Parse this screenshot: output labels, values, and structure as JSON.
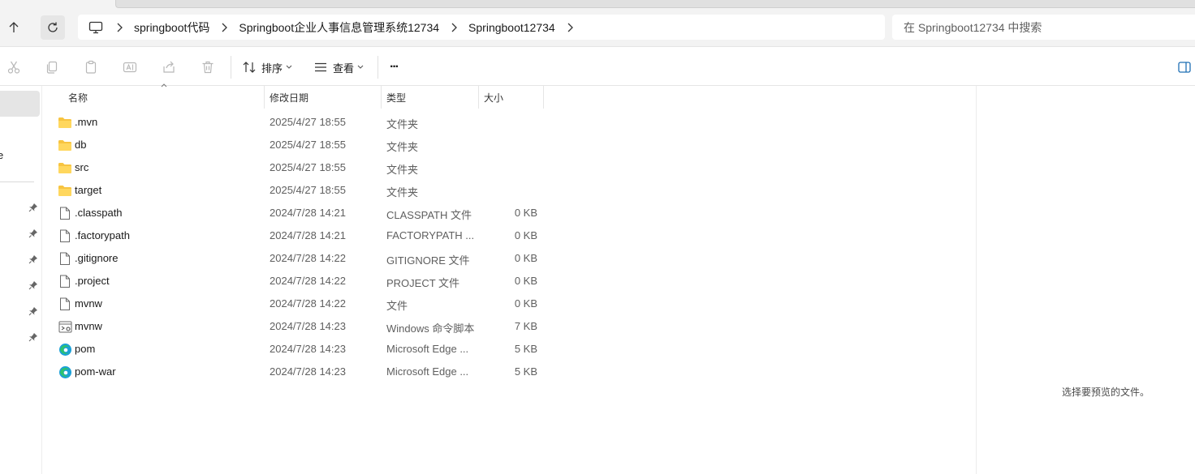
{
  "address": {
    "root_icon": "computer-icon",
    "breadcrumbs": [
      "springboot代码",
      "Springboot企业人事信息管理系统12734",
      "Springboot12734"
    ]
  },
  "search": {
    "placeholder": "在 Springboot12734 中搜索"
  },
  "toolbar": {
    "sort_label": "排序",
    "view_label": "查看",
    "more_label": "···"
  },
  "sidebar": {
    "fragment_text": "e"
  },
  "columns": {
    "name": "名称",
    "date": "修改日期",
    "type": "类型",
    "size": "大小"
  },
  "files": [
    {
      "name": ".mvn",
      "date": "2025/4/27 18:55",
      "type": "文件夹",
      "size": "",
      "icon": "folder-icon"
    },
    {
      "name": "db",
      "date": "2025/4/27 18:55",
      "type": "文件夹",
      "size": "",
      "icon": "folder-icon"
    },
    {
      "name": "src",
      "date": "2025/4/27 18:55",
      "type": "文件夹",
      "size": "",
      "icon": "folder-icon"
    },
    {
      "name": "target",
      "date": "2025/4/27 18:55",
      "type": "文件夹",
      "size": "",
      "icon": "folder-icon"
    },
    {
      "name": ".classpath",
      "date": "2024/7/28 14:21",
      "type": "CLASSPATH 文件",
      "size": "0 KB",
      "icon": "file-icon"
    },
    {
      "name": ".factorypath",
      "date": "2024/7/28 14:21",
      "type": "FACTORYPATH ...",
      "size": "0 KB",
      "icon": "file-icon"
    },
    {
      "name": ".gitignore",
      "date": "2024/7/28 14:22",
      "type": "GITIGNORE 文件",
      "size": "0 KB",
      "icon": "file-icon"
    },
    {
      "name": ".project",
      "date": "2024/7/28 14:22",
      "type": "PROJECT 文件",
      "size": "0 KB",
      "icon": "file-icon"
    },
    {
      "name": "mvnw",
      "date": "2024/7/28 14:22",
      "type": "文件",
      "size": "0 KB",
      "icon": "file-icon"
    },
    {
      "name": "mvnw",
      "date": "2024/7/28 14:23",
      "type": "Windows 命令脚本",
      "size": "7 KB",
      "icon": "script-icon"
    },
    {
      "name": "pom",
      "date": "2024/7/28 14:23",
      "type": "Microsoft Edge ...",
      "size": "5 KB",
      "icon": "edge-icon"
    },
    {
      "name": "pom-war",
      "date": "2024/7/28 14:23",
      "type": "Microsoft Edge ...",
      "size": "5 KB",
      "icon": "edge-icon"
    }
  ],
  "preview": {
    "empty_message": "选择要预览的文件。"
  }
}
